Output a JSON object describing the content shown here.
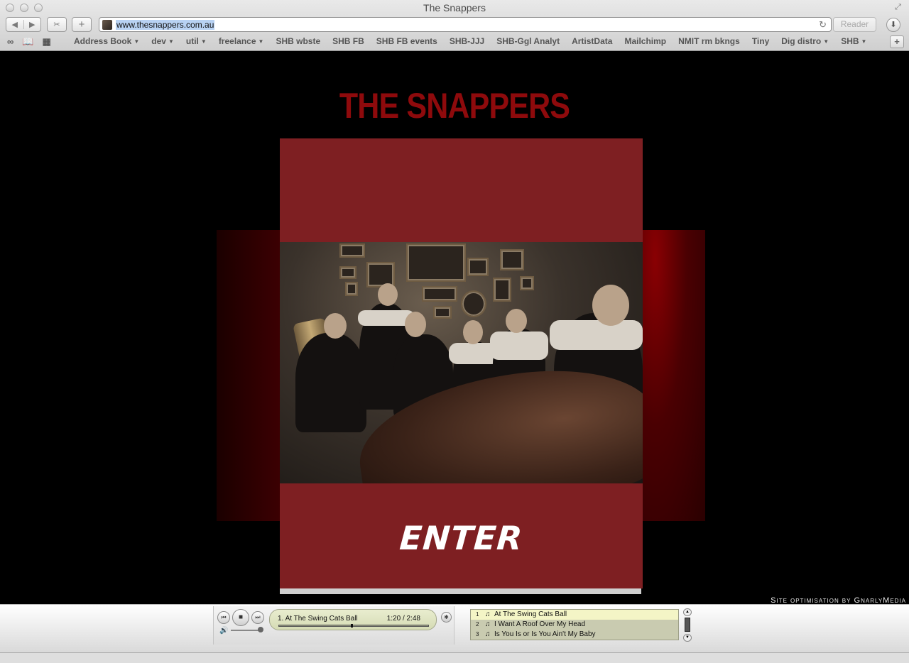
{
  "window": {
    "title": "The Snappers"
  },
  "toolbar": {
    "back_icon": "◀",
    "forward_icon": "▶",
    "share_icon": "✂",
    "add_icon": "+",
    "url": "www.thesnappers.com.au",
    "reload_icon": "↻",
    "reader_label": "Reader",
    "download_icon": "⬇"
  },
  "bookmarks": {
    "icons": [
      "∞",
      "📖",
      "▦"
    ],
    "items": [
      {
        "label": "Address Book",
        "menu": true
      },
      {
        "label": "dev",
        "menu": true
      },
      {
        "label": "util",
        "menu": true
      },
      {
        "label": "freelance",
        "menu": true
      },
      {
        "label": "SHB wbste",
        "menu": false
      },
      {
        "label": "SHB FB",
        "menu": false
      },
      {
        "label": "SHB FB events",
        "menu": false
      },
      {
        "label": "SHB-JJJ",
        "menu": false
      },
      {
        "label": "SHB-Ggl Analyt",
        "menu": false
      },
      {
        "label": "ArtistData",
        "menu": false
      },
      {
        "label": "Mailchimp",
        "menu": false
      },
      {
        "label": "NMIT rm bkngs",
        "menu": false
      },
      {
        "label": "Tiny",
        "menu": false
      },
      {
        "label": "Dig distro",
        "menu": true
      },
      {
        "label": "SHB",
        "menu": true
      }
    ],
    "add_icon": "+"
  },
  "page": {
    "logo": "THE SNAPPERS",
    "enter_label": "ENTER",
    "credit": "Site optimisation by GnarlyMedia",
    "colors": {
      "logo_red": "#8e0a0c",
      "card_red": "#7e1f22"
    }
  },
  "player": {
    "prev_icon": "⏮",
    "stop_icon": "■",
    "next_icon": "⏭",
    "volume_icon": "🔊",
    "eq_icon": "✱",
    "now_playing": "1. At The Swing Cats Ball",
    "time": "1:20 / 2:48",
    "progress": 0.48,
    "playlist": [
      {
        "num": "1",
        "title": "At The Swing Cats Ball",
        "active": true
      },
      {
        "num": "2",
        "title": "I Want A Roof Over My Head",
        "active": false
      },
      {
        "num": "3",
        "title": "Is You Is or Is You Ain't My Baby",
        "active": false
      }
    ],
    "scroll_up": "▲",
    "scroll_down": "▼",
    "note_icon": "♫"
  }
}
